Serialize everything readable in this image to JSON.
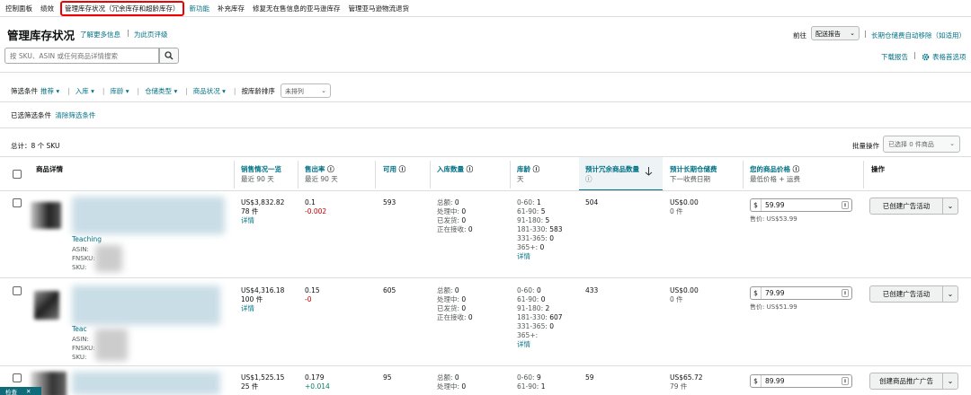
{
  "nav": {
    "items": [
      "控制面板",
      "绩效",
      "管理库存状况（冗余库存和超龄库存）",
      "新功能",
      "补充库存",
      "修复无在售信息的亚马逊库存",
      "管理亚马逊物流退货"
    ]
  },
  "header": {
    "title": "管理库存状况",
    "learn_more": "了解更多信息",
    "separator": "|",
    "rate_page": "为此页评级",
    "goto_label": "前往",
    "report_select": "配送报告",
    "ltsf_link": "长期仓储费自动移除（如适用）"
  },
  "search": {
    "placeholder": "按 SKU、ASIN 或任何商品详情搜索"
  },
  "toolbar": {
    "download": "下载报告",
    "prefs": "表格首选项"
  },
  "filters": {
    "label": "筛选条件",
    "items": [
      "推荐",
      "入库",
      "库龄",
      "仓储类型",
      "商品状况"
    ],
    "sort_label": "按库龄排序",
    "sort_value": "未排列",
    "applied_label": "已选筛选条件",
    "clear": "清除筛选条件"
  },
  "summary": {
    "total": "总计：8 个 SKU",
    "bulk_label": "批量操作",
    "bulk_select": "已选择 0 件商品"
  },
  "columns": {
    "details": "商品详情",
    "sales": "销售情况一览",
    "sales_sub": "最近 90 天",
    "sellthrough": "售出率",
    "sellthrough_sub": "最近 90 天",
    "available": "可用",
    "inbound": "入库数量",
    "age": "库龄",
    "age_sub": "天",
    "excess": "预计冗余商品数量",
    "ltsf": "预计长期仓储费",
    "ltsf_sub": "下一收费日期",
    "price": "您的商品价格",
    "price_sub": "最低价格 + 运费",
    "action": "操作"
  },
  "labels": {
    "details": "详情",
    "inbound_keys": [
      "总额:",
      "处理中:",
      "已发货:",
      "正在接收:"
    ],
    "age_keys": [
      "0-60:",
      "61-90:",
      "91-180:",
      "181-330:",
      "331-365:",
      "365+:"
    ],
    "asin": "ASIN:",
    "fnsku": "FNSKU:",
    "sku": "SKU:",
    "currency": "$",
    "spin": "⇕",
    "bottom_tab": "检查",
    "bottom_close": "✕"
  },
  "rows": [
    {
      "title_frag": "Teaching",
      "sales": "US$3,832.82",
      "units": "78 件",
      "sellthrough": "0.1",
      "sellthrough_delta": "-0.002",
      "available": "593",
      "inbound": [
        "0",
        "0",
        "0",
        "0"
      ],
      "age": [
        "1",
        "5",
        "5",
        "583",
        "0",
        "0"
      ],
      "excess": "504",
      "ltsf": "US$0.00",
      "ltsf_units": "0 件",
      "price": "59.99",
      "min_price": "售价: US$53.99",
      "action": "已创建广告活动"
    },
    {
      "title_frag": "Teac",
      "sales": "US$4,316.18",
      "units": "100 件",
      "sellthrough": "0.15",
      "sellthrough_delta": "-0",
      "available": "605",
      "inbound": [
        "0",
        "0",
        "0",
        "0"
      ],
      "age": [
        "0",
        "0",
        "2",
        "607",
        "0",
        ""
      ],
      "excess": "433",
      "ltsf": "US$0.00",
      "ltsf_units": "0 件",
      "price": "79.99",
      "min_price": "售价: US$51.99",
      "action": "已创建广告活动"
    },
    {
      "sales": "US$1,525.15",
      "units": "25 件",
      "sellthrough": "0.179",
      "sellthrough_delta": "+0.014",
      "available": "95",
      "inbound": [
        "0",
        "0"
      ],
      "age": [
        "9",
        "1"
      ],
      "excess": "59",
      "ltsf": "US$65.72",
      "ltsf_units": "79 件",
      "price": "89.99",
      "action": "创建商品推广广告"
    }
  ]
}
